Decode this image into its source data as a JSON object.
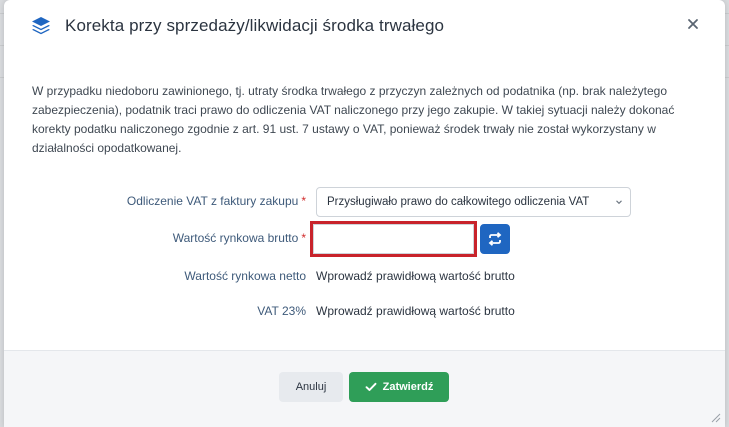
{
  "dialog": {
    "title": "Korekta przy sprzedaży/likwidacji środka trwałego",
    "intro": "W przypadku niedoboru zawinionego, tj. utraty środka trwałego z przyczyn zależnych od podatnika (np. brak należytego zabezpieczenia), podatnik traci prawo do odliczenia VAT naliczonego przy jego zakupie. W takiej sytuacji należy dokonać korekty podatku naliczonego zgodnie z art. 91 ust. 7 ustawy o VAT, ponieważ środek trwały nie został wykorzystany w działalności opodatkowanej."
  },
  "form": {
    "vat_deduction": {
      "label": "Odliczenie VAT z faktury zakupu",
      "required_mark": "*",
      "selected": "Przysługiwało prawo do całkowitego odliczenia VAT"
    },
    "gross_value": {
      "label": "Wartość rynkowa brutto",
      "required_mark": "*",
      "value": "",
      "placeholder": ""
    },
    "net_value": {
      "label": "Wartość rynkowa netto",
      "value": "Wprowadź prawidłową wartość brutto"
    },
    "vat": {
      "label": "VAT 23%",
      "value": "Wprowadź prawidłową wartość brutto"
    }
  },
  "footer": {
    "cancel_label": "Anuluj",
    "confirm_label": "Zatwierdź"
  },
  "icons": {
    "header": "layers-icon",
    "close": "close-icon",
    "recalc": "recalculate-icon",
    "confirm": "check-icon",
    "select": "chevron-down-icon"
  },
  "colors": {
    "primary": "#1f66c1",
    "success": "#2f9e58",
    "required": "#d12c2c",
    "highlight": "#c8232b"
  }
}
